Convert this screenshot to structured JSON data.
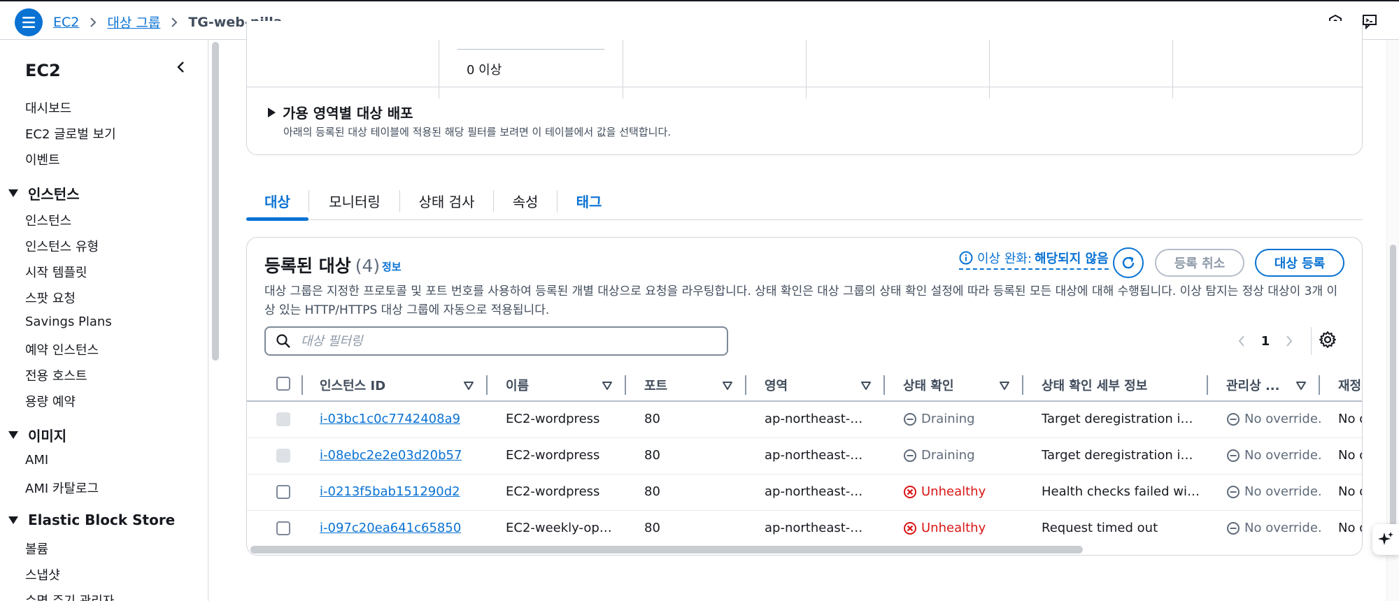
{
  "topbar": {
    "breadcrumb": [
      {
        "label": "EC2"
      },
      {
        "label": "대상 그룹"
      },
      {
        "label": "TG-web-nilla"
      }
    ]
  },
  "sidebar": {
    "title": "EC2",
    "items_top": [
      "대시보드",
      "EC2 글로벌 보기",
      "이벤트"
    ],
    "sections": [
      {
        "title": "인스턴스",
        "items": [
          "인스턴스",
          "인스턴스 유형",
          "시작 템플릿",
          "스팟 요청",
          "Savings Plans",
          "예약 인스턴스",
          "전용 호스트",
          "용량 예약"
        ]
      },
      {
        "title": "이미지",
        "items": [
          "AMI",
          "AMI 카탈로그"
        ]
      },
      {
        "title": "Elastic Block Store",
        "items": [
          "볼륨",
          "스냅샷",
          "수명 주기 관리자"
        ]
      }
    ]
  },
  "top_panel": {
    "metric_value": "0 이상",
    "az_title": "가용 영역별 대상 배포",
    "az_desc": "아래의 등록된 대상 테이블에 적용된 해당 필터를 보려면 이 테이블에서 값을 선택합니다."
  },
  "tabs": [
    {
      "label": "대상",
      "active": true
    },
    {
      "label": "모니터링"
    },
    {
      "label": "상태 검사"
    },
    {
      "label": "속성"
    },
    {
      "label": "태그"
    }
  ],
  "targets": {
    "title": "등록된 대상",
    "count": "(4)",
    "info": "정보",
    "anomaly_label": "이상 완화:",
    "anomaly_value": "해당되지 않음",
    "deregister": "등록 취소",
    "register": "대상 등록",
    "description": "대상 그룹은 지정한 프로토콜 및 포트 번호를 사용하여 등록된 개별 대상으로 요청을 라우팅합니다. 상태 확인은 대상 그룹의 상태 확인 설정에 따라 등록된 모든 대상에 대해 수행됩니다. 이상 탐지는 정상 대상이 3개 이상 있는 HTTP/HTTPS 대상 그룹에 자동으로 적용됩니다.",
    "search_placeholder": "대상 필터링",
    "page": "1",
    "columns": [
      "인스턴스 ID",
      "이름",
      "포트",
      "영역",
      "상태 확인",
      "상태 확인 세부 정보",
      "관리상 ...",
      "재정의"
    ],
    "rows": [
      {
        "id": "i-03bc1c0c7742408a9",
        "name": "EC2-wordpress",
        "port": "80",
        "zone": "ap-northeast-…",
        "health": "Draining",
        "health_type": "draining",
        "details": "Target deregistration i…",
        "admin": "No override.",
        "override": "No o",
        "checkbox_disabled": true
      },
      {
        "id": "i-08ebc2e2e03d20b57",
        "name": "EC2-wordpress",
        "port": "80",
        "zone": "ap-northeast-…",
        "health": "Draining",
        "health_type": "draining",
        "details": "Target deregistration i…",
        "admin": "No override.",
        "override": "No o",
        "checkbox_disabled": true
      },
      {
        "id": "i-0213f5bab151290d2",
        "name": "EC2-wordpress",
        "port": "80",
        "zone": "ap-northeast-…",
        "health": "Unhealthy",
        "health_type": "unhealthy",
        "details": "Health checks failed wi…",
        "admin": "No override.",
        "override": "No o",
        "checkbox_disabled": false
      },
      {
        "id": "i-097c20ea641c65850",
        "name": "EC2-weekly-op…",
        "port": "80",
        "zone": "ap-northeast-…",
        "health": "Unhealthy",
        "health_type": "unhealthy",
        "details": "Request timed out",
        "admin": "No override.",
        "override": "No o",
        "checkbox_disabled": false
      }
    ]
  },
  "colors": {
    "accent": "#0972d3",
    "error": "#d91515",
    "muted": "#5f6b7a"
  },
  "icons": [
    "menu-icon",
    "chevron-right-icon",
    "cloudshell-icon",
    "feedback-icon",
    "chevron-left-icon",
    "info-icon",
    "refresh-icon",
    "search-icon",
    "settings-icon",
    "sort-icon",
    "draining-icon",
    "unhealthy-icon",
    "no-override-icon",
    "sparkle-icon"
  ]
}
